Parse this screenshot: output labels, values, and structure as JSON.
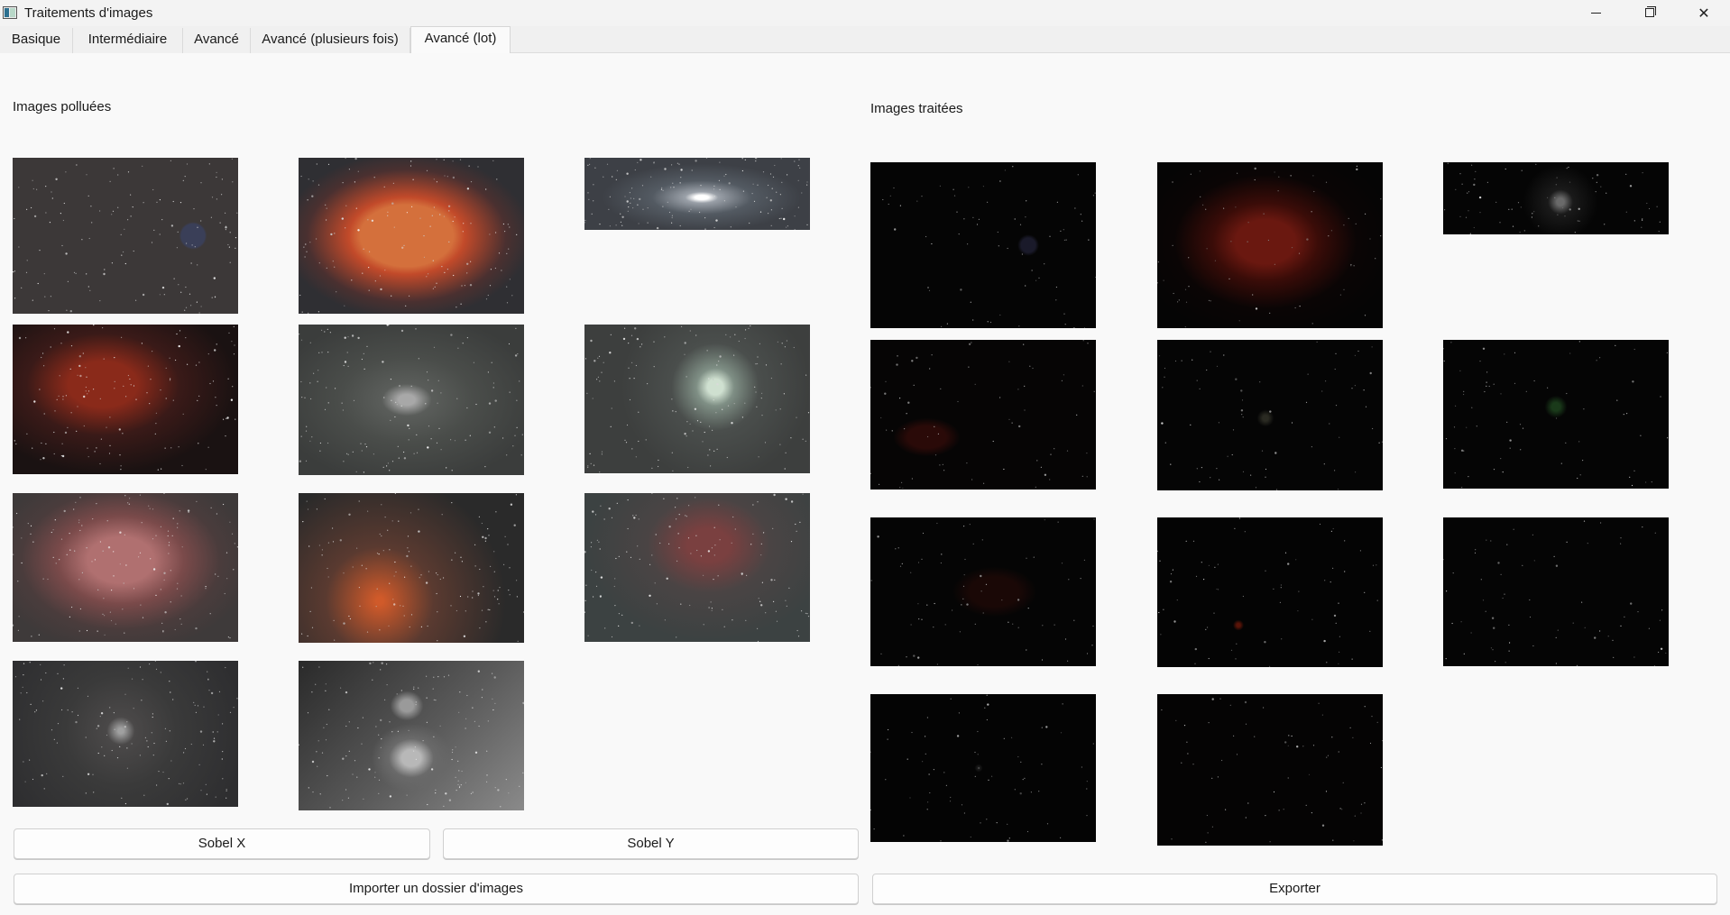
{
  "window": {
    "title": "Traitements d'images",
    "controls": {
      "minimize": "—",
      "maximize": "",
      "close": "✕"
    }
  },
  "tabs": [
    {
      "label": "Basique",
      "active": false
    },
    {
      "label": "Intermédiaire",
      "active": false
    },
    {
      "label": "Avancé",
      "active": false
    },
    {
      "label": "Avancé (plusieurs fois)",
      "active": false
    },
    {
      "label": "Avancé (lot)",
      "active": true
    }
  ],
  "left_panel": {
    "label": "Images polluées",
    "images": [
      {
        "name": "star-field",
        "background": "radial-gradient(circle at 80% 50%, #3a3f58 0 6%, transparent 7%), #3c3838"
      },
      {
        "name": "rosette-orange-nebula",
        "background": "radial-gradient(ellipse at 48% 50%, #d4703c 0 28%, #c24a2a 35%, #4a3030 60%, #2f2f33 75%)"
      },
      {
        "name": "galaxy-strip",
        "background": "radial-gradient(ellipse at 52% 55%, #ffffff 0 4%, #9aa0a8 10%, #535a62 30%, #3d4046 60%)"
      },
      {
        "name": "red-dark-nebula",
        "background": "radial-gradient(ellipse at 40% 40%, #8a2a1a 0 18%, #3a1a18 40%, #1a1212 70%), #1a1414"
      },
      {
        "name": "andromeda-gray",
        "background": "radial-gradient(ellipse at 48% 50%, #a8a8a8 0 5%, #5a5d5a 15%, #4a4d4a 40%, #3b3d3c 80%)"
      },
      {
        "name": "pinwheel-galaxy",
        "background": "radial-gradient(circle at 58% 42%, #cfe0d0 0 5%, #7f8f85 12%, #4a4e4c 28%, #3d3f3e 60%)"
      },
      {
        "name": "rosette-pink-nebula",
        "background": "radial-gradient(ellipse at 48% 45%, #b07070 0 20%, #7a4a4a 38%, #4a3c3c 60%, #3e3a3a 80%)"
      },
      {
        "name": "orange-glow",
        "background": "radial-gradient(circle at 36% 72%, #d05a2a 0 2%, #5a3a30 30%, #2a2a2a 70%), #1e2222"
      },
      {
        "name": "faint-red-nebula",
        "background": "radial-gradient(ellipse at 55% 35%, #7a4040 0 12%, #4a4444 35%, #3c4242 70%), #3a4040"
      },
      {
        "name": "globular-cluster",
        "background": "radial-gradient(circle at 48% 48%, #a0a0a0 0 2%, #4a4848 10%, #3a3a3a 40%, #2e2e30 90%)"
      },
      {
        "name": "m81-m82-pair",
        "background": "radial-gradient(ellipse at 50% 65%, #b8b8b8 0 6%, #6a6a6a 14%, transparent 25%), radial-gradient(ellipse at 48% 30%, #9a9a9a 0 4%, transparent 10%), linear-gradient(135deg, #2a2a2a 0%, #5a5a5a 55%, #8a8a8a 100%)"
      }
    ]
  },
  "right_panel": {
    "label": "Images traitées",
    "images": [
      {
        "name": "processed-star-field",
        "background": "radial-gradient(circle at 70% 50%, #1a1a2a 0 4%, transparent 6%), #050505"
      },
      {
        "name": "processed-rosette",
        "background": "radial-gradient(ellipse at 48% 48%, #6a1810 0 18%, #3a0c08 32%, #0a0505 55%, #050505 80%)"
      },
      {
        "name": "processed-galaxy-strip",
        "background": "radial-gradient(circle at 52% 55%, #6a6a6a 0 3%, #1a1a1a 10%, #050505 30%)"
      },
      {
        "name": "processed-red-nebula",
        "background": "radial-gradient(ellipse at 25% 65%, #2a0a08 0 8%, transparent 14%), #060505"
      },
      {
        "name": "processed-andromeda",
        "background": "radial-gradient(circle at 48% 52%, #2a2a22 0 2%, transparent 6%), #050505"
      },
      {
        "name": "processed-pinwheel",
        "background": "radial-gradient(circle at 50% 45%, #1a3a1a 0 3%, transparent 8%), #050505"
      },
      {
        "name": "processed-rosette-pink",
        "background": "radial-gradient(ellipse at 55% 50%, #1a0806 0 14%, transparent 24%), #050505"
      },
      {
        "name": "processed-orange-glow",
        "background": "radial-gradient(circle at 36% 72%, #5a1408 0 1%, transparent 3%), #040404"
      },
      {
        "name": "processed-faint-nebula",
        "background": "#050505"
      },
      {
        "name": "processed-globular",
        "background": "radial-gradient(circle at 48% 50%, #1a1a1a 0 1%, transparent 3%), #040404"
      },
      {
        "name": "processed-m81-m82",
        "background": "#050404"
      }
    ]
  },
  "buttons": {
    "sobel_x": "Sobel X",
    "sobel_y": "Sobel Y",
    "import_folder": "Importer un dossier d'images",
    "export": "Exporter"
  }
}
